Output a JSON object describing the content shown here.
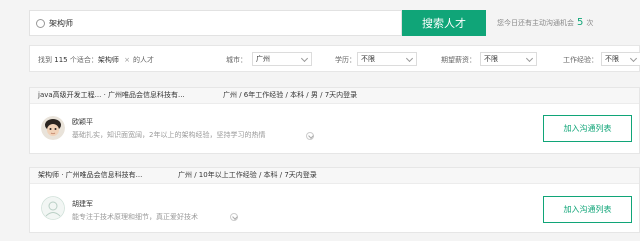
{
  "search": {
    "value": "架构师",
    "button_label": "搜索人才",
    "quota_prefix": "您今日还有主动沟通机会",
    "quota_count": "5",
    "quota_suffix": "次"
  },
  "filters": {
    "found_prefix": "找到",
    "found_count": "115",
    "found_mid": "个适合：",
    "keyword": "架构师",
    "remove": "×",
    "found_suffix": "的人才",
    "city_label": "城市：",
    "city_value": "广州",
    "edu_label": "学历：",
    "edu_value": "不限",
    "salary_label": "期望薪资：",
    "salary_value": "不限",
    "exp_label": "工作经验：",
    "exp_value": "不限"
  },
  "candidates": [
    {
      "title": "java高级开发工程... · 广州唯品会信息科技有...",
      "meta": "广州 / 6年工作经验 / 本科 / 男 / 7天内登录",
      "name": "欧颖平",
      "desc": "基础扎实，知识面宽阔，2年以上的架构经验，坚持学习的热情",
      "action": "加入沟通列表"
    },
    {
      "title": "架构师 · 广州唯品会信息科技有...",
      "meta": "广州 / 10年以上工作经验 / 本科 / 7天内登录",
      "name": "胡建军",
      "desc": "能专注于技术原理和细节，真正爱好技术",
      "action": "加入沟通列表"
    }
  ],
  "colors": {
    "accent": "#10a578"
  }
}
